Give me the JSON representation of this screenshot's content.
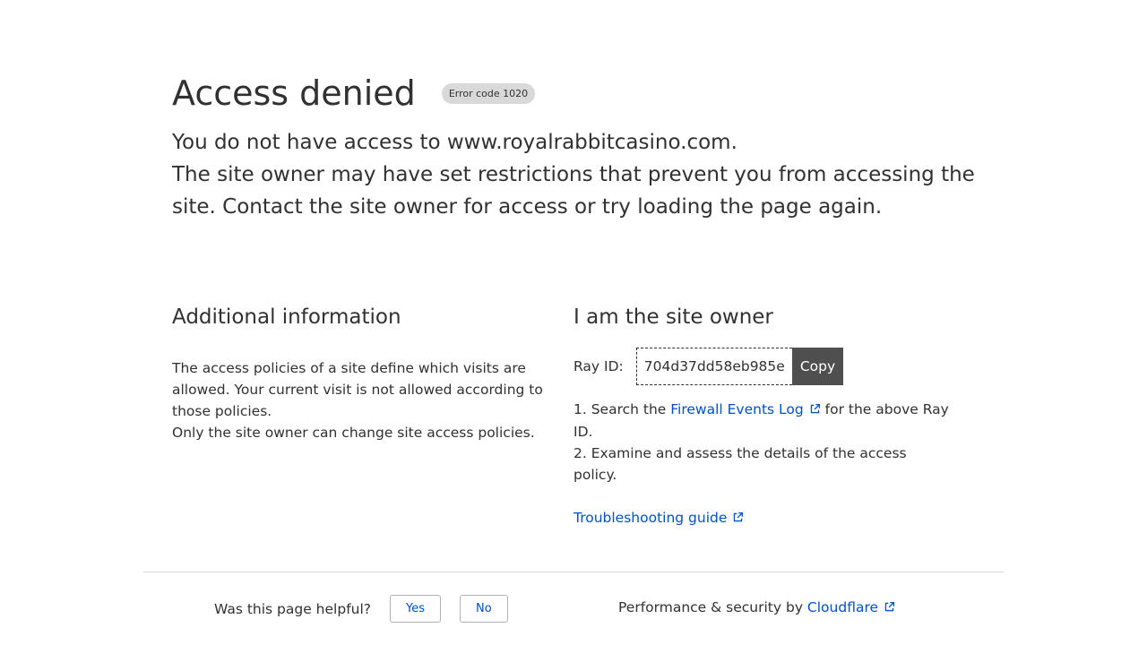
{
  "header": {
    "title": "Access denied",
    "error_badge": "Error code 1020",
    "lead_line1": "You do not have access to www.royalrabbitcasino.com.",
    "lead_line2": "The site owner may have set restrictions that prevent you from accessing the site. Contact the site owner for access or try loading the page again."
  },
  "additional_info": {
    "heading": "Additional information",
    "para1": "The access policies of a site define which visits are allowed. Your current visit is not allowed according to those policies.",
    "para2": "Only the site owner can change site access policies."
  },
  "site_owner": {
    "heading": "I am the site owner",
    "ray_label": "Ray ID:",
    "ray_id": "704d37dd58eb985e",
    "copy_label": "Copy",
    "step1_prefix": "1. Search the ",
    "step1_link": "Firewall Events Log",
    "step1_suffix": " for the above Ray ID.",
    "step2": "2. Examine and assess the details of the access policy.",
    "troubleshoot_link": "Troubleshooting guide"
  },
  "footer": {
    "helpful_question": "Was this page helpful?",
    "yes_label": "Yes",
    "no_label": "No",
    "perf_text": "Performance & security by ",
    "cloudflare_link": "Cloudflare"
  },
  "colors": {
    "text": "#313131",
    "link": "#0051c3",
    "badge_bg": "#d9d9d9",
    "copy_bg": "#4f4f4f"
  },
  "icons": {
    "external_link": "external-link-icon"
  }
}
